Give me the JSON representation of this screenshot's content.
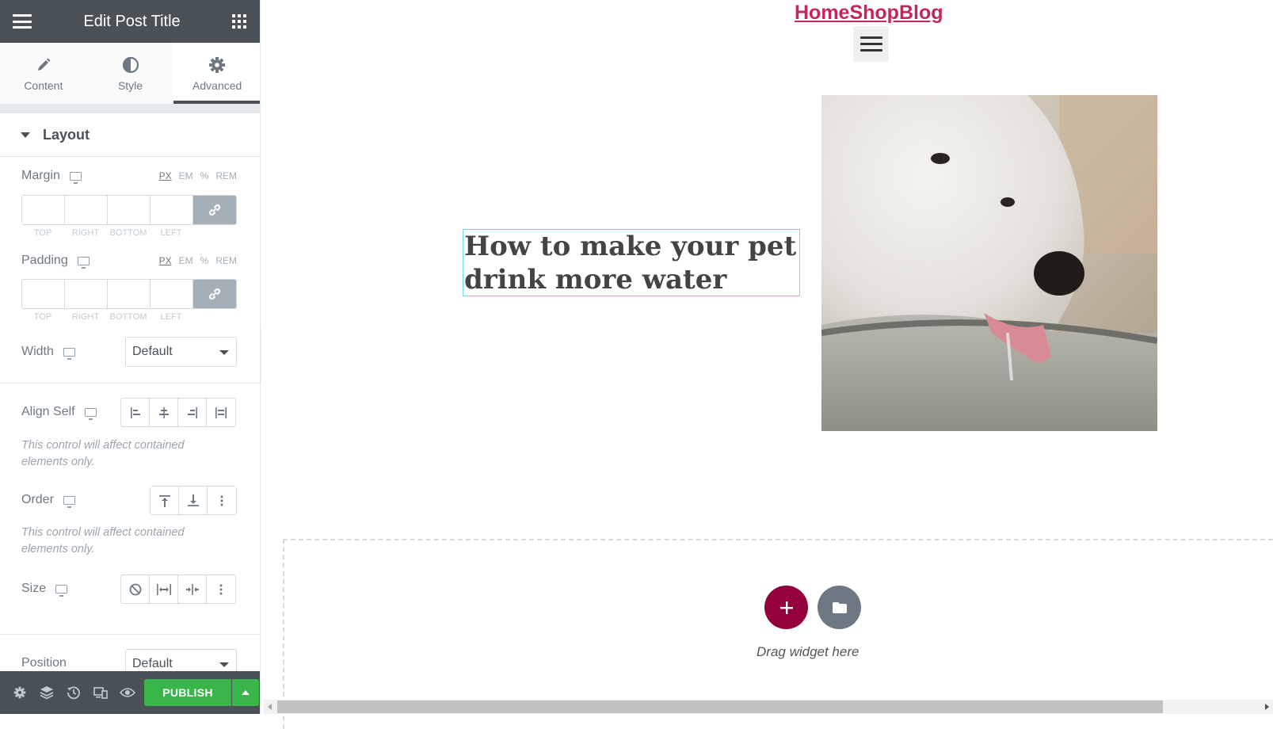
{
  "panel": {
    "title": "Edit Post Title",
    "tabs": [
      {
        "label": "Content",
        "icon": "pencil-icon"
      },
      {
        "label": "Style",
        "icon": "contrast-icon"
      },
      {
        "label": "Advanced",
        "icon": "gear-icon",
        "active": true
      }
    ],
    "section": {
      "label": "Layout"
    },
    "margin": {
      "label": "Margin",
      "units": [
        "PX",
        "EM",
        "%",
        "REM"
      ],
      "dims": [
        "TOP",
        "RIGHT",
        "BOTTOM",
        "LEFT"
      ]
    },
    "padding": {
      "label": "Padding",
      "units": [
        "PX",
        "EM",
        "%",
        "REM"
      ],
      "dims": [
        "TOP",
        "RIGHT",
        "BOTTOM",
        "LEFT"
      ]
    },
    "width": {
      "label": "Width",
      "value": "Default"
    },
    "align_self": {
      "label": "Align Self",
      "note": "This control will affect contained elements only."
    },
    "order": {
      "label": "Order",
      "note": "This control will affect contained elements only."
    },
    "size": {
      "label": "Size"
    },
    "position": {
      "label": "Position",
      "value": "Default"
    }
  },
  "footer": {
    "publish_label": "PUBLISH",
    "icons": [
      "gear-icon",
      "layers-icon",
      "history-icon",
      "responsive-icon",
      "eye-icon"
    ]
  },
  "preview": {
    "site_title": "HomeShopBlog",
    "post_title": "How to make your pet drink more water",
    "drag_text": "Drag widget here"
  },
  "colors": {
    "panel_header": "#495157",
    "publish": "#39b54a",
    "brand": "#c4275a",
    "add_button": "#93003c",
    "selection_outline": "#71d7f7"
  }
}
